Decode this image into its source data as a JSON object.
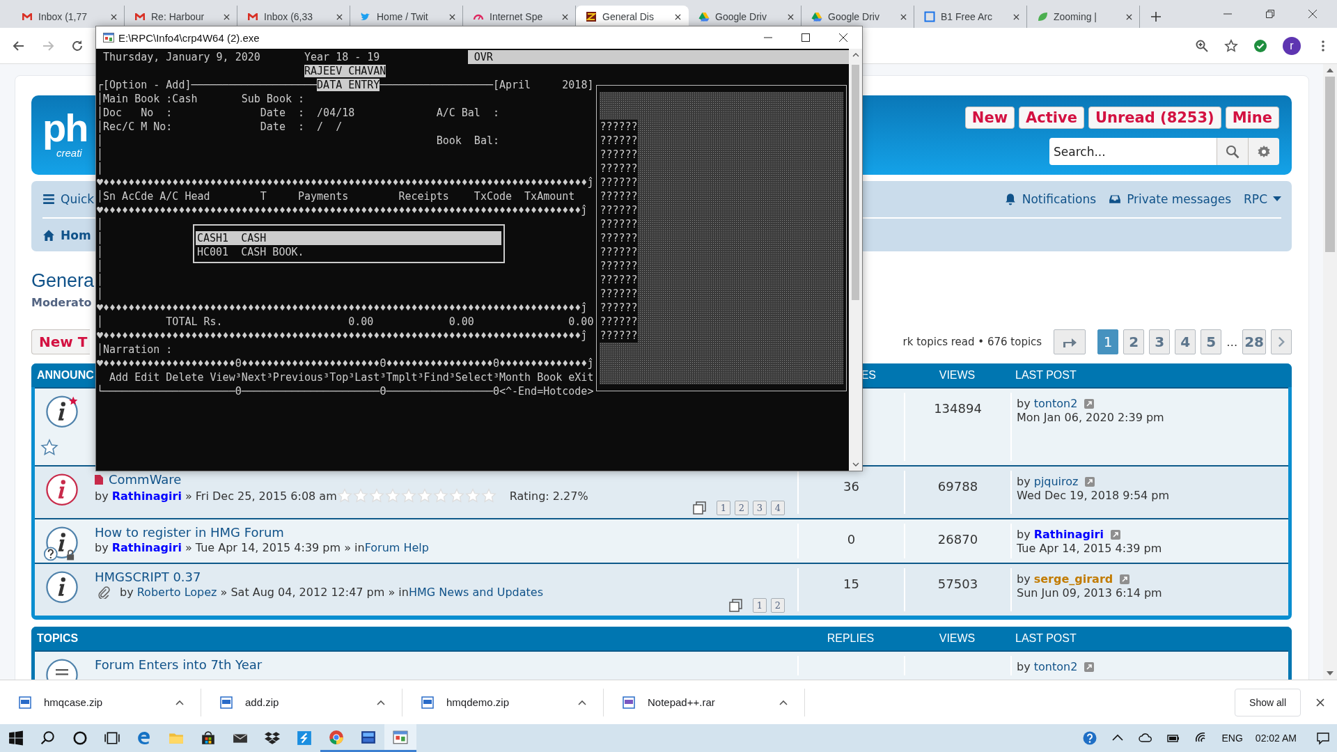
{
  "browser": {
    "tabs": [
      {
        "title": "Inbox (1,77",
        "kind": "mail",
        "selected": false
      },
      {
        "title": "Re: Harbour",
        "kind": "mail",
        "selected": false
      },
      {
        "title": "Inbox (6,33",
        "kind": "mail",
        "selected": false
      },
      {
        "title": "Home / Twit",
        "kind": "bird",
        "selected": false
      },
      {
        "title": "Internet Spe",
        "kind": "gauge",
        "selected": false
      },
      {
        "title": "General Dis",
        "kind": "forum",
        "selected": true
      },
      {
        "title": "Google Driv",
        "kind": "drive",
        "selected": false
      },
      {
        "title": "Google Driv",
        "kind": "drive",
        "selected": false
      },
      {
        "title": "B1 Free Arc",
        "kind": "square",
        "selected": false
      },
      {
        "title": "Zooming |",
        "kind": "leaf",
        "selected": false
      }
    ],
    "profile": "r"
  },
  "console": {
    "title": "E:\\RPC\\Info4\\crp4W64 (2).exe",
    "status": {
      "date": "Thursday, January 9, 2020",
      "year": "Year 18 - 19",
      "mode": "OVR",
      "user": "RAJEEV CHAVAN"
    },
    "lines": [
      [
        {
          "text": "┌[Option - Add]",
          "inverse": false
        },
        {
          "text": "────────────────────",
          "inverse": false
        },
        {
          "text": "DATA ENTRY",
          "inverse": true
        },
        {
          "text": "──────────────────[April     2018]",
          "inverse": false
        }
      ],
      [
        {
          "text": "│Main Book :Cash       Sub Book :",
          "inverse": false
        }
      ],
      [
        {
          "text": "│Doc   No  :              Date  :  /04/18             A/C Bal  :",
          "inverse": false
        }
      ],
      [
        {
          "text": "│Rec/C M No:              Date  :  /  /",
          "inverse": false
        }
      ],
      [
        {
          "text": "│                                                     Book  Bal:",
          "inverse": false
        }
      ],
      [
        {
          "text": "│",
          "inverse": false
        }
      ],
      [
        {
          "text": "│",
          "inverse": false
        }
      ],
      [
        {
          "text": "♥♦♦♦♦♦♦♦♦♦♦♦♦♦♦♦♦♦♦♦♦♦♦♦♦♦♦♦♦♦♦♦♦♦♦♦♦♦♦♦♦♦♦♦♦♦♦♦♦♦♦♦♦♦♦♦♦♦♦♦♦♦♦♦♦♦♦♦♦♦♦♦♦♦♦♦♦♦ĵ",
          "inverse": false
        }
      ],
      [
        {
          "text": "│Sn AcCde A/C Head        T     Payments        Receipts    TxCode  TxAmount",
          "inverse": false
        }
      ],
      [
        {
          "text": "♥♦♦♦♦♦♦♦♦♦♦♦♦♦♦♦♦♦♦♦♦♦♦♦♦♦♦♦♦♦♦♦♦♦♦♦♦♦♦♦♦♦♦♦♦♦♦♦♦♦♦♦♦♦♦♦♦♦♦♦♦♦♦♦♦♦♦♦♦♦♦♦♦♦♦♦♦ĵ",
          "inverse": false
        }
      ],
      [
        {
          "text": "│",
          "inverse": false
        }
      ],
      [
        {
          "text": "│",
          "inverse": false
        }
      ],
      [
        {
          "text": "│",
          "inverse": false
        }
      ],
      [
        {
          "text": "│",
          "inverse": false
        }
      ],
      [
        {
          "text": "│",
          "inverse": false
        }
      ],
      [
        {
          "text": "│",
          "inverse": false
        }
      ],
      [
        {
          "text": "♥♦♦♦♦♦♦♦♦♦♦♦♦♦♦♦♦♦♦♦♦♦♦♦♦♦♦♦♦♦♦♦♦♦♦♦♦♦♦♦♦♦♦♦♦♦♦♦♦♦♦♦♦♦♦♦♦♦♦♦♦♦♦♦♦♦♦♦♦♦♦♦♦♦♦♦♦ĵ",
          "inverse": false
        }
      ],
      [
        {
          "text": "│          TOTAL Rs.                    0.00            0.00               0.00",
          "inverse": false
        }
      ],
      [
        {
          "text": "♥♦♦♦♦♦♦♦♦♦♦♦♦♦♦♦♦♦♦♦♦♦♦♦♦♦♦♦♦♦♦♦♦♦♦♦♦♦♦♦♦♦♦♦♦♦♦♦♦♦♦♦♦♦♦♦♦♦♦♦♦♦♦♦♦♦♦♦♦♦♦♦♦♦♦♦♦ĵ",
          "inverse": false
        }
      ],
      [
        {
          "text": "│Narration :",
          "inverse": false
        }
      ],
      [
        {
          "text": "♥♦♦♦♦♦♦♦♦♦♦♦♦♦♦♦♦♦♦♦♦♦Θ♦♦♦♦♦♦♦♦♦♦♦♦♦♦♦♦♦♦♦♦♦♦Θ♦♦♦♦♦♦♦♦♦♦♦♦♦♦♦♦♦Θ♦♦♦♦♦♦♦♦♦♦♦♦♦♦ĵ",
          "inverse": false
        }
      ],
      [
        {
          "text": "  Add Edit Delete View³Next³Previous³Top³Last³Tmplt³Find³Select³Month Book eXit",
          "inverse": false
        }
      ],
      [
        {
          "text": "└─────────────────────Θ──────────────────────Θ─────────────────Θ<^-End=Hotcode>",
          "inverse": false
        }
      ]
    ],
    "popup": {
      "items": [
        {
          "text": "CASH1  CASH",
          "selected": true
        },
        {
          "text": "HC001  CASH BOOK.",
          "selected": false
        }
      ]
    },
    "panel": {
      "lines": [
        "??????",
        "??????",
        "??????",
        "??????",
        "??????",
        "??????",
        "??????",
        "??????",
        "??????",
        "??????",
        "??????",
        "??????",
        "??????",
        "??????",
        "??????",
        "??????"
      ]
    }
  },
  "forum": {
    "logo": {
      "mark": "ph",
      "tagline": "creati"
    },
    "quick_links": [
      {
        "label": "New"
      },
      {
        "label": "Active"
      },
      {
        "label": "Unread (8253)"
      },
      {
        "label": "Mine"
      }
    ],
    "search": {
      "placeholder": "Search..."
    },
    "nav": {
      "quick": "Quick",
      "home": "Hom",
      "notifications": "Notifications",
      "messages": "Private messages",
      "user": "RPC"
    },
    "title": "Genera",
    "moderators": "Moderato",
    "new_topic": "New T",
    "summary": "rk topics read • 676 topics",
    "pages": [
      {
        "label": "1",
        "kind": "page",
        "selected": true
      },
      {
        "label": "2",
        "kind": "page",
        "selected": false
      },
      {
        "label": "3",
        "kind": "page",
        "selected": false
      },
      {
        "label": "4",
        "kind": "page",
        "selected": false
      },
      {
        "label": "5",
        "kind": "page",
        "selected": false
      },
      {
        "label": "…",
        "kind": "gap",
        "selected": false
      },
      {
        "label": "28",
        "kind": "page",
        "selected": false
      }
    ],
    "announcements": {
      "columns": [
        "ANNOUNC",
        "ES",
        "VIEWS",
        "LAST POST"
      ],
      "rows": [
        {
          "kind": "starred",
          "views": "134894",
          "last_post": {
            "prefix": "by",
            "name": "tonton2",
            "color": "#105289",
            "coloured": false,
            "date": "Mon Jan 06, 2020 2:39 pm"
          }
        },
        {
          "kind": "hot",
          "new_posts": true,
          "attachment": false,
          "title": "CommWare",
          "author": {
            "prefix": "by",
            "name": "Rathinagiri",
            "color": "#0000ff",
            "coloured": true,
            "after": "» Fri Dec 25, 2015 6:08 am"
          },
          "stars": 0,
          "rating": "Rating: 2.27%",
          "pages": [
            "1",
            "2",
            "3",
            "4"
          ],
          "replies": "36",
          "views": "69788",
          "last_post": {
            "prefix": "by",
            "name": "pjquiroz",
            "color": "#105289",
            "coloured": false,
            "date": "Wed Dec 19, 2018 9:54 pm"
          }
        },
        {
          "kind": "locked",
          "new_posts": false,
          "attachment": false,
          "title": "How to register in HMG Forum",
          "author": {
            "prefix": "by",
            "name": "Rathinagiri",
            "color": "#0000ff",
            "coloured": true,
            "after": "» Tue Apr 14, 2015 4:39 pm » in"
          },
          "forum": "Forum Help",
          "replies": "0",
          "views": "26870",
          "last_post": {
            "prefix": "by",
            "name": "Rathinagiri",
            "color": "#0000ff",
            "coloured": true,
            "date": "Tue Apr 14, 2015 4:39 pm"
          }
        },
        {
          "kind": "plain",
          "new_posts": false,
          "attachment": true,
          "title": "HMGSCRIPT 0.37",
          "author": {
            "prefix": "by",
            "name": "Roberto Lopez",
            "color": "#105289",
            "coloured": false,
            "after": "» Sat Aug 04, 2012 12:47 pm » in"
          },
          "forum": "HMG News and Updates",
          "pages": [
            "1",
            "2"
          ],
          "replies": "15",
          "views": "57503",
          "last_post": {
            "prefix": "by",
            "name": "serge_girard",
            "color": "#c27b00",
            "coloured": true,
            "date": "Sun Jun 09, 2013 6:14 pm"
          }
        }
      ]
    },
    "topics": {
      "columns": [
        "TOPICS",
        "REPLIES",
        "VIEWS",
        "LAST POST"
      ],
      "rows": [
        {
          "kind": "plain",
          "title": "Forum Enters into 7th Year",
          "last_post": {
            "prefix": "by",
            "name": "tonton2",
            "color": "#105289",
            "coloured": false
          }
        }
      ]
    }
  },
  "downloads": {
    "items": [
      {
        "name": "hmqcase.zip",
        "kind": "zip"
      },
      {
        "name": "add.zip",
        "kind": "zip"
      },
      {
        "name": "hmqdemo.zip",
        "kind": "zip"
      },
      {
        "name": "Notepad++.rar",
        "kind": "rar"
      }
    ],
    "show_all": "Show all"
  },
  "taskbar": {
    "apps": [
      {
        "kind": "start",
        "running": false,
        "selected": false
      },
      {
        "kind": "search",
        "running": false,
        "selected": false
      },
      {
        "kind": "cortana",
        "running": false,
        "selected": false
      },
      {
        "kind": "taskview",
        "running": false,
        "selected": false
      },
      {
        "kind": "edge",
        "running": false,
        "selected": false
      },
      {
        "kind": "explorer",
        "running": false,
        "selected": false
      },
      {
        "kind": "store",
        "running": false,
        "selected": false
      },
      {
        "kind": "mail",
        "running": false,
        "selected": false
      },
      {
        "kind": "dropbox",
        "running": false,
        "selected": false
      },
      {
        "kind": "sway",
        "running": false,
        "selected": false
      },
      {
        "kind": "chrome",
        "running": true,
        "selected": false
      },
      {
        "kind": "tool",
        "running": true,
        "selected": false
      },
      {
        "kind": "window",
        "running": true,
        "selected": true
      }
    ],
    "language": "ENG",
    "time": "02:02 AM"
  }
}
